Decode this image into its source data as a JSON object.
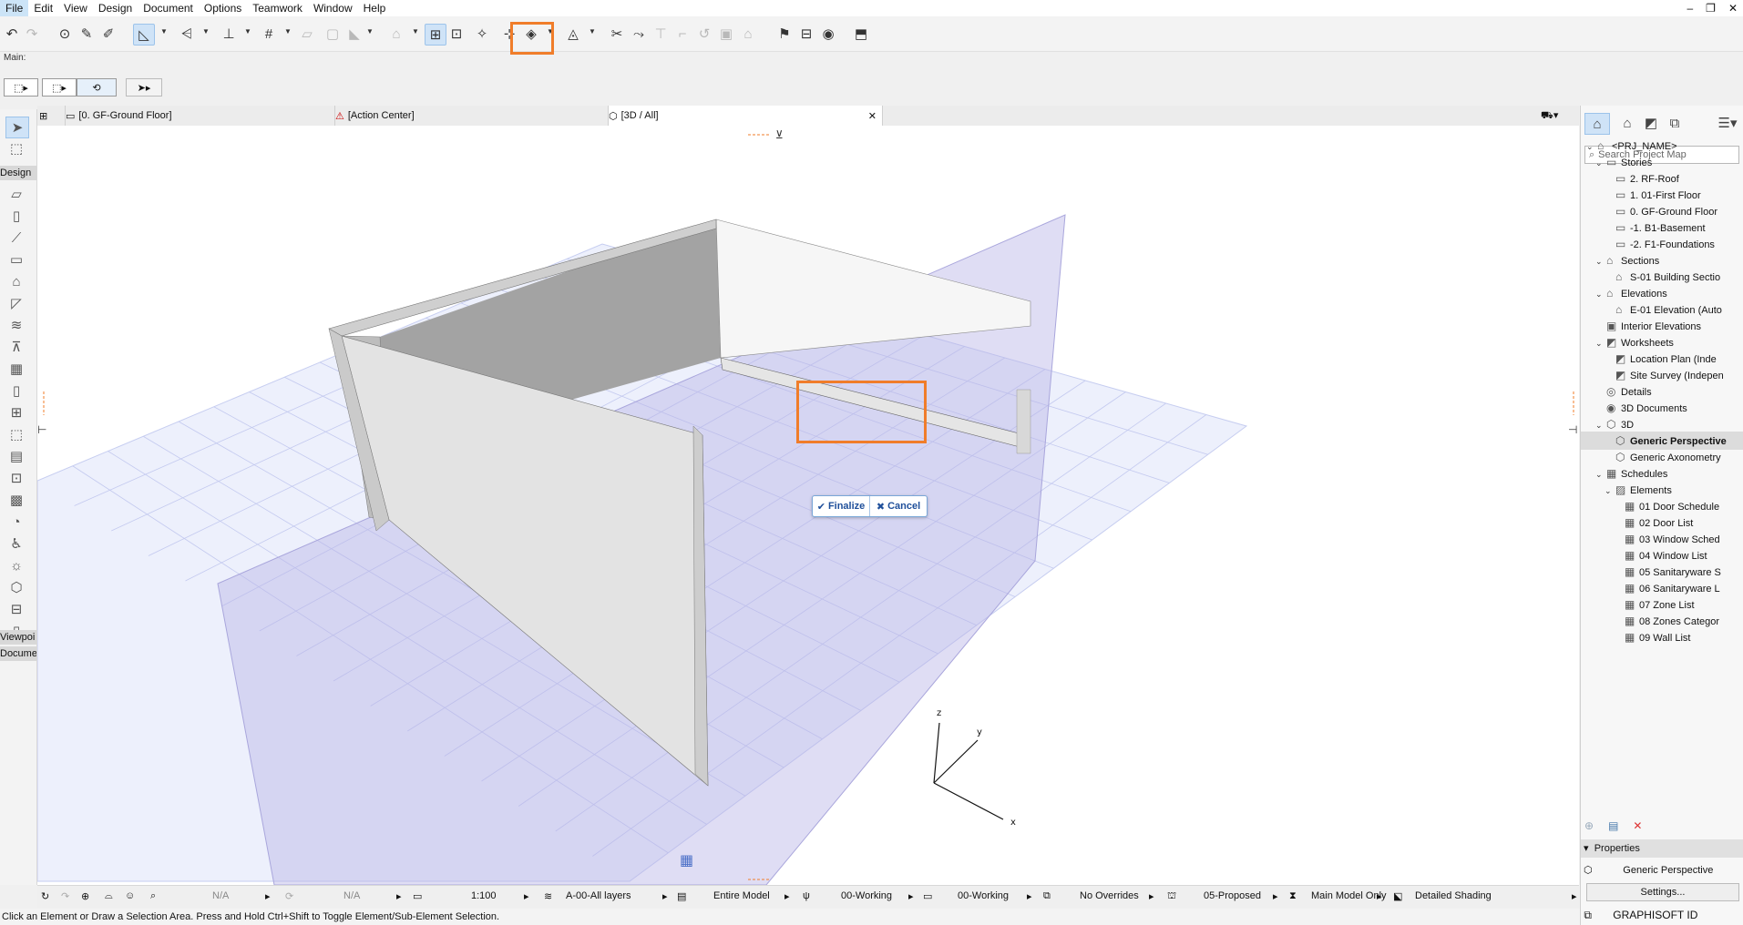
{
  "menu": [
    "File",
    "Edit",
    "View",
    "Design",
    "Document",
    "Options",
    "Teamwork",
    "Window",
    "Help"
  ],
  "info_label": "Main:",
  "tabs": [
    {
      "label": "[0. GF-Ground Floor]"
    },
    {
      "label": "[Action Center]"
    },
    {
      "label": "[3D / All]"
    }
  ],
  "popup": {
    "finalize": "Finalize",
    "cancel": "Cancel"
  },
  "axes": {
    "x": "x",
    "y": "y",
    "z": "z"
  },
  "toolbox_groups": [
    "Design",
    "Viewpoi",
    "Docume"
  ],
  "project_map": {
    "search_placeholder": "Search Project Map",
    "items": [
      {
        "label": "<PRJ_NAME>",
        "level": 0,
        "arrow": "v",
        "icon": "house"
      },
      {
        "label": "Stories",
        "level": 1,
        "arrow": "v",
        "icon": "stories"
      },
      {
        "label": "2. RF-Roof",
        "level": 2,
        "arrow": "",
        "icon": "story"
      },
      {
        "label": "1. 01-First Floor",
        "level": 2,
        "arrow": "",
        "icon": "story"
      },
      {
        "label": "0. GF-Ground Floor",
        "level": 2,
        "arrow": "",
        "icon": "story"
      },
      {
        "label": "-1. B1-Basement",
        "level": 2,
        "arrow": "",
        "icon": "story"
      },
      {
        "label": "-2. F1-Foundations",
        "level": 2,
        "arrow": "",
        "icon": "story"
      },
      {
        "label": "Sections",
        "level": 1,
        "arrow": "v",
        "icon": "section"
      },
      {
        "label": "S-01 Building Sectio",
        "level": 2,
        "arrow": "",
        "icon": "section"
      },
      {
        "label": "Elevations",
        "level": 1,
        "arrow": "v",
        "icon": "elevation"
      },
      {
        "label": "E-01 Elevation (Auto",
        "level": 2,
        "arrow": "",
        "icon": "elevation"
      },
      {
        "label": "Interior Elevations",
        "level": 1,
        "arrow": "",
        "icon": "interior"
      },
      {
        "label": "Worksheets",
        "level": 1,
        "arrow": "v",
        "icon": "worksheet"
      },
      {
        "label": "Location Plan (Inde",
        "level": 2,
        "arrow": "",
        "icon": "worksheet"
      },
      {
        "label": "Site Survey (Indepen",
        "level": 2,
        "arrow": "",
        "icon": "worksheet"
      },
      {
        "label": "Details",
        "level": 1,
        "arrow": "",
        "icon": "details"
      },
      {
        "label": "3D Documents",
        "level": 1,
        "arrow": "",
        "icon": "3ddoc"
      },
      {
        "label": "3D",
        "level": 1,
        "arrow": "v",
        "icon": "3d"
      },
      {
        "label": "Generic Perspective",
        "level": 2,
        "arrow": "",
        "icon": "3d",
        "selected": true
      },
      {
        "label": "Generic Axonometry",
        "level": 2,
        "arrow": "",
        "icon": "3d"
      },
      {
        "label": "Schedules",
        "level": 1,
        "arrow": "v",
        "icon": "schedule"
      },
      {
        "label": "Elements",
        "level": 2,
        "arrow": "v",
        "icon": "elements"
      },
      {
        "label": "01 Door Schedule",
        "level": 3,
        "arrow": "",
        "icon": "schedule"
      },
      {
        "label": "02 Door List",
        "level": 3,
        "arrow": "",
        "icon": "schedule"
      },
      {
        "label": "03 Window Sched",
        "level": 3,
        "arrow": "",
        "icon": "schedule"
      },
      {
        "label": "04 Window List",
        "level": 3,
        "arrow": "",
        "icon": "schedule"
      },
      {
        "label": "05 Sanitaryware S",
        "level": 3,
        "arrow": "",
        "icon": "schedule"
      },
      {
        "label": "06 Sanitaryware L",
        "level": 3,
        "arrow": "",
        "icon": "schedule"
      },
      {
        "label": "07 Zone List",
        "level": 3,
        "arrow": "",
        "icon": "schedule"
      },
      {
        "label": "08 Zones Categor",
        "level": 3,
        "arrow": "",
        "icon": "schedule"
      },
      {
        "label": "09 Wall List",
        "level": 3,
        "arrow": "",
        "icon": "schedule"
      }
    ]
  },
  "properties": {
    "header": "Properties",
    "value": "Generic Perspective",
    "settings": "Settings..."
  },
  "graphisoft_id": "GRAPHISOFT ID",
  "status": {
    "na1": "N/A",
    "na2": "N/A",
    "scale": "1:100",
    "layers": "A-00-All layers",
    "model": "Entire Model",
    "pen1": "00-Working",
    "pen2": "00-Working",
    "overrides": "No Overrides",
    "renovation": "05-Proposed",
    "structure": "Main Model Only",
    "shading": "Detailed Shading"
  },
  "hint": "Click an Element or Draw a Selection Area. Press and Hold Ctrl+Shift to Toggle Element/Sub-Element Selection.",
  "colors": {
    "highlight": "#f07d2a",
    "selection": "#cfe3f7",
    "plane": "#b7b4e6"
  }
}
